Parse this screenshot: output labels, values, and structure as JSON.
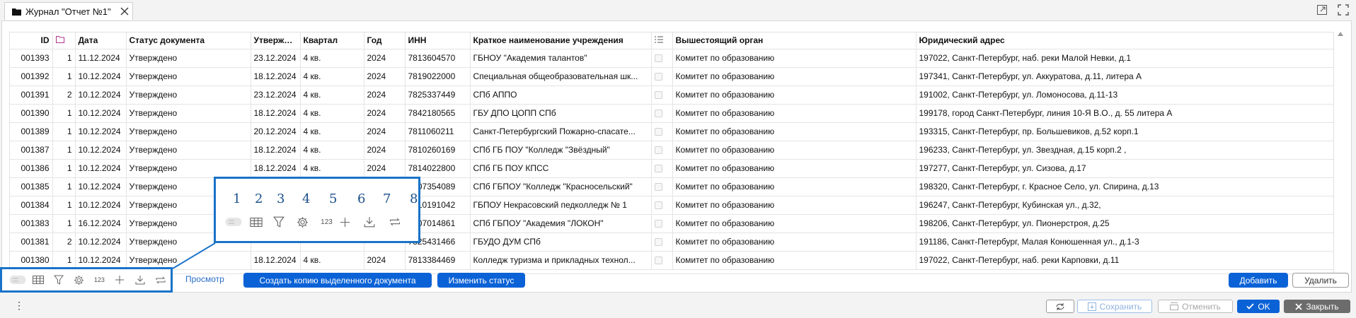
{
  "tab": {
    "title": "Журнал \"Отчет №1\""
  },
  "columns": [
    {
      "key": "id",
      "label": "ID"
    },
    {
      "key": "files",
      "label": ""
    },
    {
      "key": "date",
      "label": "Дата"
    },
    {
      "key": "status",
      "label": "Статус документа"
    },
    {
      "key": "approved",
      "label": "Утвержден"
    },
    {
      "key": "quarter",
      "label": "Квартал"
    },
    {
      "key": "year",
      "label": "Год"
    },
    {
      "key": "inn",
      "label": "ИНН"
    },
    {
      "key": "name",
      "label": "Краткое наименование учреждения"
    },
    {
      "key": "flag",
      "label": ""
    },
    {
      "key": "parent",
      "label": "Вышестоящий орган"
    },
    {
      "key": "address",
      "label": "Юридический адрес"
    }
  ],
  "rows": [
    [
      "001393",
      "1",
      "11.12.2024",
      "Утверждено",
      "23.12.2024",
      "4 кв.",
      "2024",
      "7813604570",
      "ГБНОУ \"Академия талантов\"",
      "Комитет по образованию",
      "197022, Санкт-Петербург, наб. реки Малой Невки, д.1"
    ],
    [
      "001392",
      "1",
      "10.12.2024",
      "Утверждено",
      "18.12.2024",
      "4 кв.",
      "2024",
      "7819022000",
      "Специальная общеобразовательная шк...",
      "Комитет по образованию",
      "197341, Санкт-Петербург, ул. Аккуратова, д.11, литера А"
    ],
    [
      "001391",
      "2",
      "10.12.2024",
      "Утверждено",
      "23.12.2024",
      "4 кв.",
      "2024",
      "7825337449",
      "СПб АППО",
      "Комитет по образованию",
      "191002, Санкт-Петербург, ул. Ломоносова, д.11-13"
    ],
    [
      "001390",
      "1",
      "10.12.2024",
      "Утверждено",
      "18.12.2024",
      "4 кв.",
      "2024",
      "7842180565",
      "ГБУ ДПО ЦОПП СПб",
      "Комитет по образованию",
      "199178, город Санкт-Петербург, линия 10-Я В.О., д. 55 литера А"
    ],
    [
      "001389",
      "1",
      "10.12.2024",
      "Утверждено",
      "20.12.2024",
      "4 кв.",
      "2024",
      "7811060211",
      "Санкт-Петербургский Пожарно-спасате...",
      "Комитет по образованию",
      "193315, Санкт-Петербург, пр. Большевиков, д.52 корп.1"
    ],
    [
      "001387",
      "1",
      "10.12.2024",
      "Утверждено",
      "18.12.2024",
      "4 кв.",
      "2024",
      "7810260169",
      "СПб ГБ ПОУ \"Колледж \"Звёздный\"",
      "Комитет по образованию",
      "196233, Санкт-Петербург, ул. Звездная, д.15 корп.2 ,"
    ],
    [
      "001386",
      "1",
      "10.12.2024",
      "Утверждено",
      "18.12.2024",
      "4 кв.",
      "2024",
      "7814022800",
      "СПб ГБ ПОУ КПСС",
      "Комитет по образованию",
      "197277, Санкт-Петербург, ул. Сизова, д.17"
    ],
    [
      "001385",
      "1",
      "10.12.2024",
      "Утверждено",
      "",
      "",
      "",
      "7807354089",
      "СПб ГБПОУ \"Колледж \"Красносельский\"",
      "Комитет по образованию",
      "198320, Санкт-Петербург, г. Красное Село, ул. Спирина, д.13"
    ],
    [
      "001384",
      "1",
      "10.12.2024",
      "Утверждено",
      "",
      "",
      "",
      "7810191042",
      "ГБПОУ Некрасовский педколледж № 1",
      "Комитет по образованию",
      "196247, Санкт-Петербург, Кубинская ул., д.32,"
    ],
    [
      "001383",
      "1",
      "16.12.2024",
      "Утверждено",
      "",
      "",
      "",
      "7807014861",
      "СПб ГБПОУ \"Академия \"ЛОКОН\"",
      "Комитет по образованию",
      "198206, Санкт-Петербург, ул. Пионерстроя, д.25"
    ],
    [
      "001381",
      "2",
      "10.12.2024",
      "Утверждено",
      "",
      "",
      "",
      "7825431466",
      "ГБУДО ДУМ СПб",
      "Комитет по образованию",
      "191186, Санкт-Петербург, Малая Конюшенная ул., д.1-3"
    ],
    [
      "001380",
      "1",
      "10.12.2024",
      "Утверждено",
      "18.12.2024",
      "4 кв.",
      "2024",
      "7813384469",
      "Колледж туризма и прикладных технол...",
      "Комитет по образованию",
      "197022, Санкт-Петербург, наб. реки Карповки, д.11"
    ]
  ],
  "toolbar": {
    "view_link": "Просмотр",
    "copy_button": "Создать копию выделенного документа",
    "status_button": "Изменить статус",
    "add_button": "Добавить",
    "delete_button": "Удалить",
    "counter_glyph": "123"
  },
  "callout": {
    "numbers": [
      "1",
      "2",
      "3",
      "4",
      "5",
      "6",
      "7",
      "8"
    ],
    "counter_glyph": "123"
  },
  "footer": {
    "save": "Сохранить",
    "cancel": "Отменить",
    "ok": "OK",
    "close": "Закрыть"
  },
  "colors": {
    "accent": "#0b62d6",
    "highlight_border": "#1a73c8"
  }
}
